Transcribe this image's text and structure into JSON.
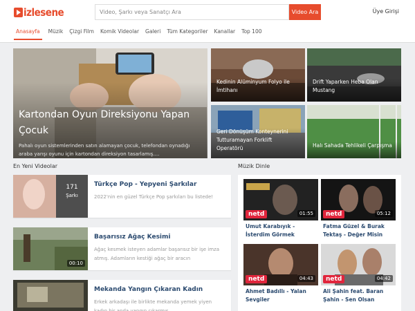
{
  "header": {
    "logo_text": "izlesene",
    "search_placeholder": "Video, Şarkı veya Sanatçı Ara",
    "search_button": "Video Ara",
    "login": "Üye Girişi"
  },
  "nav": {
    "items": [
      "Anasayfa",
      "Müzik",
      "Çizgi Film",
      "Komik Videolar",
      "Galeri",
      "Tüm Kategoriler",
      "Kanallar",
      "Top 100"
    ],
    "active": "Anasayfa"
  },
  "featured": {
    "hero": {
      "title": "Kartondan Oyun Direksiyonu Yapan Çocuk",
      "desc": "Pahalı oyun sistemlerinden satın alamayan çocuk, telefondan oynadığı araba yarışı oyunu için kartondan direksiyon tasarlamış...."
    },
    "small": [
      {
        "title": "Kedinin Alüminyum Folyo ile İmtihanı"
      },
      {
        "title": "Drift Yaparken Heba Olan Mustang"
      },
      {
        "title": "Geri Dönüşüm Konteynerini Tutturamayan Forklift Operatörü"
      },
      {
        "title": "Halı Sahada Tehlikeli Çarpışma"
      }
    ]
  },
  "latest": {
    "heading": "En Yeni Videolar",
    "items": [
      {
        "title": "Türkçe Pop - Yepyeni Şarkılar",
        "desc": "2022'nin en güzel Türkçe Pop şarkıları bu listede!",
        "count": "171",
        "count_label": "Şarkı"
      },
      {
        "title": "Başarısız Ağaç Kesimi",
        "desc": "Ağaç kesmek isteyen adamlar başarısız bir işe imza atmış. Adamların kestiği ağaç bir aracın",
        "duration": "00:10"
      },
      {
        "title": "Mekanda Yangın Çıkaran Kadın",
        "desc": "Erkek arkadaşı ile birlikte mekanda yemek yiyen kadın bir anda yangın çıkarmış"
      }
    ]
  },
  "music": {
    "heading": "Müzik Dinle",
    "items": [
      {
        "title": "Umut Karabıyık - İsterdim Görmek",
        "duration": "01:55",
        "badge": "netd"
      },
      {
        "title": "Fatma Güzel & Burak Tektaş - Değer Misin",
        "duration": "05:12",
        "badge": "netd"
      },
      {
        "title": "Ahmet Badıllı - Yalan Sevgiler",
        "duration": "04:43",
        "badge": "netd"
      },
      {
        "title": "Ali Şahin feat. Baran Şahin - Sen Olsan",
        "duration": "04:42",
        "badge": "netd"
      }
    ]
  },
  "colors": {
    "brand": "#e74c2d",
    "title": "#2b4a6f",
    "netd": "#e1253c"
  }
}
